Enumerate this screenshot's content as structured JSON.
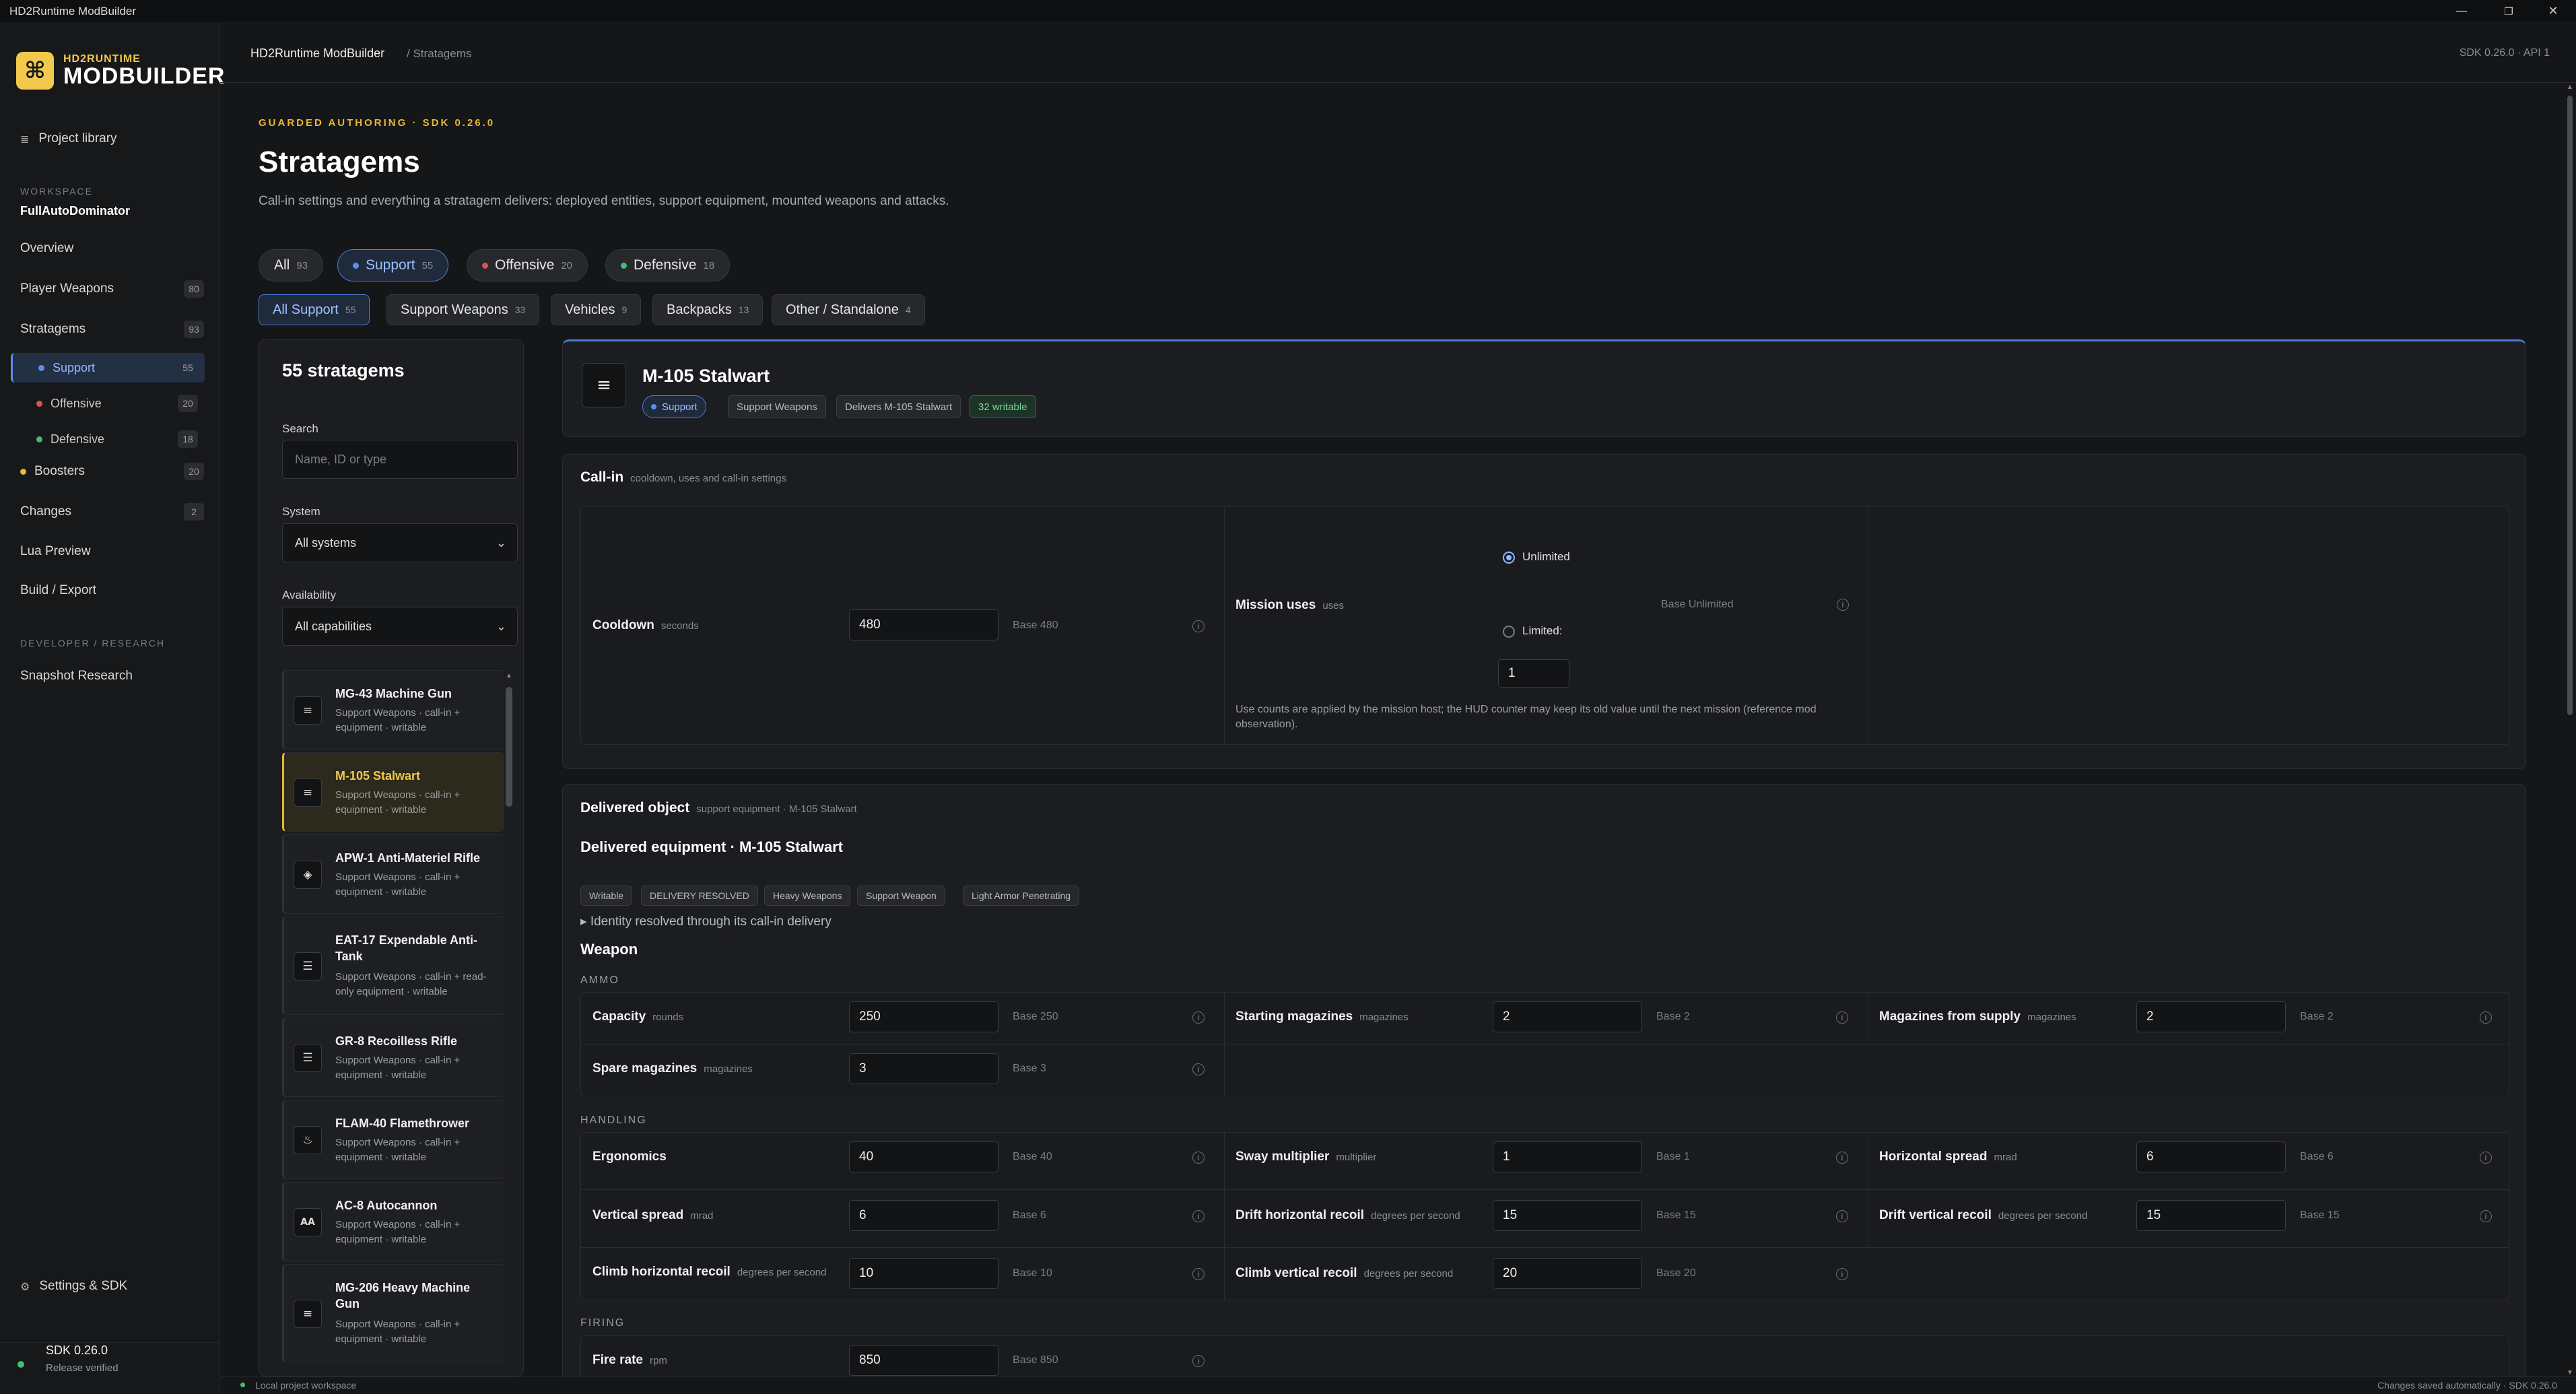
{
  "window": {
    "title": "HD2Runtime ModBuilder",
    "controls": [
      "—",
      "❐",
      "✕"
    ]
  },
  "logo": {
    "top": "HD2RUNTIME",
    "bottom": "MODBUILDER"
  },
  "sidebar": {
    "project_library": "Project library",
    "workspace_label": "WORKSPACE",
    "workspace_name": "FullAutoDominator",
    "items": [
      {
        "label": "Overview",
        "count": ""
      },
      {
        "label": "Player Weapons",
        "count": "80"
      },
      {
        "label": "Stratagems",
        "count": "93"
      }
    ],
    "subitems": [
      {
        "label": "Support",
        "count": "55",
        "color": "#5b8ef0"
      },
      {
        "label": "Offensive",
        "count": "20",
        "color": "#e0524d"
      },
      {
        "label": "Defensive",
        "count": "18",
        "color": "#3fbf72"
      }
    ],
    "boosters": {
      "label": "Boosters",
      "count": "20",
      "color": "#e8b931"
    },
    "changes": {
      "label": "Changes",
      "count": "2"
    },
    "lua_preview": "Lua Preview",
    "build_export": "Build / Export",
    "dev_label": "DEVELOPER / RESEARCH",
    "snapshot": "Snapshot Research",
    "settings": "Settings & SDK",
    "sdk_version": "SDK 0.26.0",
    "sdk_status": "Release verified"
  },
  "header": {
    "app": "HD2Runtime ModBuilder",
    "crumb": "/ Stratagems",
    "sdk": "SDK 0.26.0 · API 1"
  },
  "page": {
    "eyebrow": "GUARDED AUTHORING · SDK 0.26.0",
    "title": "Stratagems",
    "subtitle": "Call-in settings and everything a stratagem delivers: deployed entities, support equipment, mounted weapons and attacks."
  },
  "categories": [
    {
      "label": "All",
      "count": "93"
    },
    {
      "label": "Support",
      "count": "55"
    },
    {
      "label": "Offensive",
      "count": "20"
    },
    {
      "label": "Defensive",
      "count": "18"
    }
  ],
  "filters": [
    {
      "label": "All Support",
      "count": "55"
    },
    {
      "label": "Support Weapons",
      "count": "33"
    },
    {
      "label": "Vehicles",
      "count": "9"
    },
    {
      "label": "Backpacks",
      "count": "13"
    },
    {
      "label": "Other / Standalone",
      "count": "4"
    }
  ],
  "list_panel": {
    "count_title": "55 stratagems",
    "search_label": "Search",
    "search_placeholder": "Name, ID or type",
    "system_label": "System",
    "system_value": "All systems",
    "availability_label": "Availability",
    "availability_value": "All capabilities",
    "items": [
      {
        "name": "MG-43 Machine Gun",
        "meta": "Support Weapons · call-in + equipment · writable",
        "icon": "≡"
      },
      {
        "name": "M-105 Stalwart",
        "meta": "Support Weapons · call-in + equipment · writable",
        "icon": "≡"
      },
      {
        "name": "APW-1 Anti-Materiel Rifle",
        "meta": "Support Weapons · call-in + equipment · writable",
        "icon": "◈"
      },
      {
        "name": "EAT-17 Expendable Anti-Tank",
        "meta": "Support Weapons · call-in + read-only equipment · writable",
        "icon": "☰"
      },
      {
        "name": "GR-8 Recoilless Rifle",
        "meta": "Support Weapons · call-in + equipment · writable",
        "icon": "☰"
      },
      {
        "name": "FLAM-40 Flamethrower",
        "meta": "Support Weapons · call-in + equipment · writable",
        "icon": "♨"
      },
      {
        "name": "AC-8 Autocannon",
        "meta": "Support Weapons · call-in + equipment · writable",
        "icon": "AA"
      },
      {
        "name": "MG-206 Heavy Machine Gun",
        "meta": "Support Weapons · call-in + equipment · writable",
        "icon": "≡"
      }
    ]
  },
  "detail": {
    "title": "M-105 Stalwart",
    "icon": "≡",
    "tags": [
      "Support",
      "Support Weapons",
      "Delivers M-105 Stalwart",
      "32 writable"
    ],
    "callin": {
      "title": "Call-in",
      "sub": "cooldown, uses and call-in settings",
      "cooldown_label": "Cooldown",
      "cooldown_unit": "seconds",
      "cooldown_value": "480",
      "cooldown_base": "Base 480",
      "uses_label": "Mission uses",
      "uses_unit": "uses",
      "unlimited": "Unlimited",
      "limited": "Limited:",
      "limited_value": "1",
      "uses_base": "Base Unlimited",
      "note": "Use counts are applied by the mission host; the HUD counter may keep its old value until the next mission (reference mod observation)."
    },
    "delivered": {
      "title": "Delivered object",
      "sub": "support equipment · M-105 Stalwart",
      "equipment_title": "Delivered equipment · M-105 Stalwart",
      "tags": [
        "Writable",
        "DELIVERY RESOLVED",
        "Heavy Weapons",
        "Support Weapon",
        "Light Armor Penetrating"
      ],
      "identity": "▸ Identity resolved through its call-in delivery",
      "weapon_title": "Weapon",
      "groups": {
        "ammo": "AMMO",
        "handling": "HANDLING",
        "firing": "FIRING"
      },
      "ammo": [
        {
          "label": "Capacity",
          "unit": "rounds",
          "value": "250",
          "base": "Base 250"
        },
        {
          "label": "Starting magazines",
          "unit": "magazines",
          "value": "2",
          "base": "Base 2"
        },
        {
          "label": "Magazines from supply",
          "unit": "magazines",
          "value": "2",
          "base": "Base 2"
        },
        {
          "label": "Spare magazines",
          "unit": "magazines",
          "value": "3",
          "base": "Base 3"
        }
      ],
      "handling": [
        {
          "label": "Ergonomics",
          "unit": "",
          "value": "40",
          "base": "Base 40"
        },
        {
          "label": "Sway multiplier",
          "unit": "multiplier",
          "value": "1",
          "base": "Base 1"
        },
        {
          "label": "Horizontal spread",
          "unit": "mrad",
          "value": "6",
          "base": "Base 6"
        },
        {
          "label": "Vertical spread",
          "unit": "mrad",
          "value": "6",
          "base": "Base 6"
        },
        {
          "label": "Drift horizontal recoil",
          "unit": "degrees per second",
          "value": "15",
          "base": "Base 15"
        },
        {
          "label": "Drift vertical recoil",
          "unit": "degrees per second",
          "value": "15",
          "base": "Base 15"
        },
        {
          "label": "Climb horizontal recoil",
          "unit": "degrees per second",
          "value": "10",
          "base": "Base 10"
        },
        {
          "label": "Climb vertical recoil",
          "unit": "degrees per second",
          "value": "20",
          "base": "Base 20"
        }
      ],
      "firing": [
        {
          "label": "Fire rate",
          "unit": "rpm",
          "value": "850",
          "base": "Base 850"
        }
      ]
    }
  },
  "statusbar": {
    "left": "Local project workspace",
    "right": "Changes saved automatically · SDK 0.26.0"
  }
}
